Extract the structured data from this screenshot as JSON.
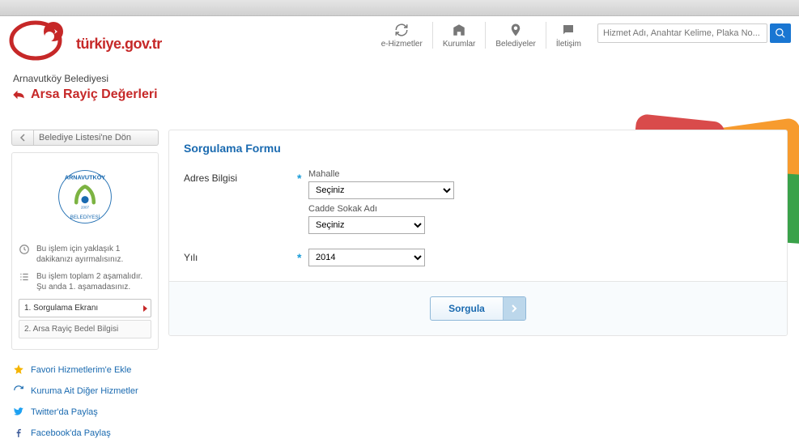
{
  "site": {
    "name": "türkiye.gov.tr"
  },
  "nav": {
    "items": [
      {
        "label": "e-Hizmetler"
      },
      {
        "label": "Kurumlar"
      },
      {
        "label": "Belediyeler"
      },
      {
        "label": "İletişim"
      }
    ]
  },
  "search": {
    "placeholder": "Hizmet Adı, Anahtar Kelime, Plaka No..."
  },
  "breadcrumb": "Arnavutköy Belediyesi",
  "page_title": "Arsa Rayiç Değerleri",
  "back": {
    "label": "Belediye Listesi'ne Dön"
  },
  "info": {
    "duration": "Bu işlem için yaklaşık 1 dakikanızı ayırmalısınız.",
    "steps_info": "Bu işlem toplam 2 aşamalıdır. Şu anda 1. aşamadasınız."
  },
  "steps": [
    {
      "label": "1. Sorgulama Ekranı",
      "active": true
    },
    {
      "label": "2. Arsa Rayiç Bedel Bilgisi",
      "active": false
    }
  ],
  "sidelinks": [
    {
      "label": "Favori Hizmetlerim'e Ekle"
    },
    {
      "label": "Kuruma Ait Diğer Hizmetler"
    },
    {
      "label": "Twitter'da Paylaş"
    },
    {
      "label": "Facebook'da Paylaş"
    }
  ],
  "form": {
    "title": "Sorgulama Formu",
    "address_label": "Adres Bilgisi",
    "mahalle_label": "Mahalle",
    "mahalle_selected": "Seçiniz",
    "cadde_label": "Cadde Sokak Adı",
    "cadde_selected": "Seçiniz",
    "year_label": "Yılı",
    "year_selected": "2014",
    "submit": "Sorgula"
  }
}
